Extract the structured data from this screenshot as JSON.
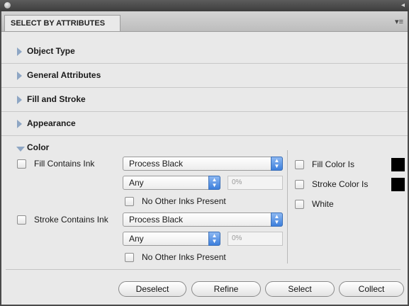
{
  "panel": {
    "tab_label": "SELECT BY ATTRIBUTES",
    "menu_icon": "panel-menu-icon"
  },
  "sections": [
    {
      "label": "Object Type",
      "expanded": false
    },
    {
      "label": "General Attributes",
      "expanded": false
    },
    {
      "label": "Fill and Stroke",
      "expanded": false
    },
    {
      "label": "Appearance",
      "expanded": false
    },
    {
      "label": "Color",
      "expanded": true
    }
  ],
  "color": {
    "fill_contains_ink": "Fill Contains Ink",
    "fill_ink_value": "Process Black",
    "fill_tint_value": "Any",
    "fill_percent": "0%",
    "fill_no_other_inks": "No Other Inks Present",
    "stroke_contains_ink": "Stroke Contains Ink",
    "stroke_ink_value": "Process Black",
    "stroke_tint_value": "Any",
    "stroke_percent": "0%",
    "stroke_no_other_inks": "No Other Inks Present",
    "fill_color_is": "Fill Color Is",
    "stroke_color_is": "Stroke Color Is",
    "white": "White",
    "fill_swatch_color": "#000000",
    "stroke_swatch_color": "#000000"
  },
  "buttons": {
    "deselect": "Deselect",
    "refine": "Refine",
    "select": "Select",
    "collect": "Collect"
  }
}
